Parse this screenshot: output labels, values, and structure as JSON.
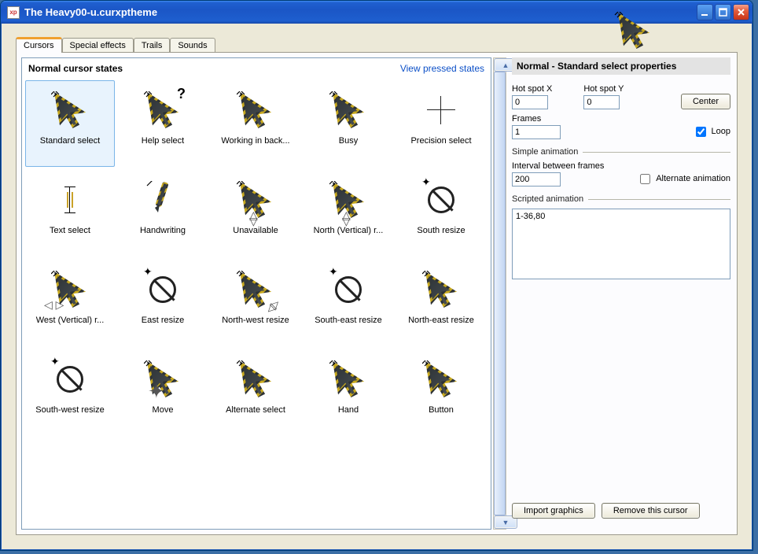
{
  "window": {
    "title": "The Heavy00-u.curxptheme"
  },
  "tabs": [
    {
      "label": "Cursors",
      "active": true
    },
    {
      "label": "Special effects",
      "active": false
    },
    {
      "label": "Trails",
      "active": false
    },
    {
      "label": "Sounds",
      "active": false
    }
  ],
  "left": {
    "heading": "Normal cursor states",
    "link": "View pressed states",
    "cursors": [
      {
        "label": "Standard select",
        "kind": "arrow",
        "selected": true
      },
      {
        "label": "Help select",
        "kind": "arrow-help"
      },
      {
        "label": "Working in back...",
        "kind": "arrow"
      },
      {
        "label": "Busy",
        "kind": "arrow"
      },
      {
        "label": "Precision select",
        "kind": "crosshair"
      },
      {
        "label": "Text select",
        "kind": "ibeam"
      },
      {
        "label": "Handwriting",
        "kind": "pen"
      },
      {
        "label": "Unavailable",
        "kind": "arrow-ud"
      },
      {
        "label": "North (Vertical) r...",
        "kind": "arrow-ud"
      },
      {
        "label": "South resize",
        "kind": "forbid"
      },
      {
        "label": "West (Vertical) r...",
        "kind": "arrow-lr"
      },
      {
        "label": "East resize",
        "kind": "forbid"
      },
      {
        "label": "North-west resize",
        "kind": "arrow-diag"
      },
      {
        "label": "South-east resize",
        "kind": "forbid"
      },
      {
        "label": "North-east resize",
        "kind": "arrow"
      },
      {
        "label": "South-west resize",
        "kind": "forbid"
      },
      {
        "label": "Move",
        "kind": "arrow-move"
      },
      {
        "label": "Alternate select",
        "kind": "arrow"
      },
      {
        "label": "Hand",
        "kind": "arrow"
      },
      {
        "label": "Button",
        "kind": "arrow"
      }
    ]
  },
  "right": {
    "title": "Normal - Standard select properties",
    "hotspot_x_label": "Hot spot X",
    "hotspot_y_label": "Hot spot Y",
    "hotspot_x": "0",
    "hotspot_y": "0",
    "center_label": "Center",
    "frames_label": "Frames",
    "frames": "1",
    "loop_label": "Loop",
    "loop_checked": true,
    "group_simple": "Simple animation",
    "interval_label": "Interval between frames",
    "interval": "200",
    "alt_anim_label": "Alternate animation",
    "alt_anim_checked": false,
    "group_script": "Scripted animation",
    "script": "1-36,80",
    "import_label": "Import graphics",
    "remove_label": "Remove this cursor"
  },
  "icons": {
    "arrow_fill": "#2e3336",
    "arrow_stripe": "#c7a81e"
  }
}
